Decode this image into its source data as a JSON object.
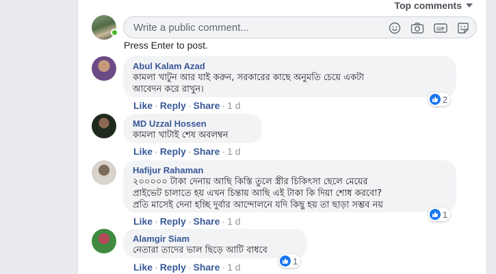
{
  "sort": {
    "label": "Top comments"
  },
  "composer": {
    "placeholder": "Write a public comment...",
    "hint": "Press Enter to post.",
    "icons": [
      "emoji-icon",
      "camera-icon",
      "gif-icon",
      "sticker-icon"
    ]
  },
  "actions": {
    "like": "Like",
    "reply": "Reply",
    "share": "Share",
    "sep": "·"
  },
  "comments": [
    {
      "author": "Abul Kalam Azad",
      "lines": [
        "কামলা খাটুন আর যাই করুন, সরকারের কাছে অনুমতি চেয়ে একটা",
        "আবেদন করে রাখুন।"
      ],
      "time": "1 d",
      "reactions": "2"
    },
    {
      "author": "MD Uzzal Hossen",
      "lines": [
        "কামলা খাটাই শেষ অবলম্বন"
      ],
      "time": "1 d",
      "reactions": ""
    },
    {
      "author": "Hafijur Rahaman",
      "lines": [
        "২০০০০০ টাকা দেনায় আছি কিস্তি তুলে স্ত্রীর চিকিৎসা ছেলে মেয়ের",
        "প্রাইভেট চালাতে হয় এখন চিন্তায় আছি এই টাকা কি দিয়া শোধ করবো?",
        "প্রতি মাসেই দেনা হচ্ছি দুর্বার আন্দোলনে যদি কিছু হয় তা ছাড়া সম্ভব নয়"
      ],
      "time": "1 d",
      "reactions": "1"
    },
    {
      "author": "Alamgir Siam",
      "lines": [
        "নেতারা তাদের ভাল ছিড়ে আটি বাধবে"
      ],
      "time": "1 d",
      "reactions": "1"
    }
  ],
  "colors": {
    "link": "#385898",
    "like_blue": "#1877f2",
    "bubble": "#f2f3f5",
    "page_bg": "#e9ebee"
  }
}
